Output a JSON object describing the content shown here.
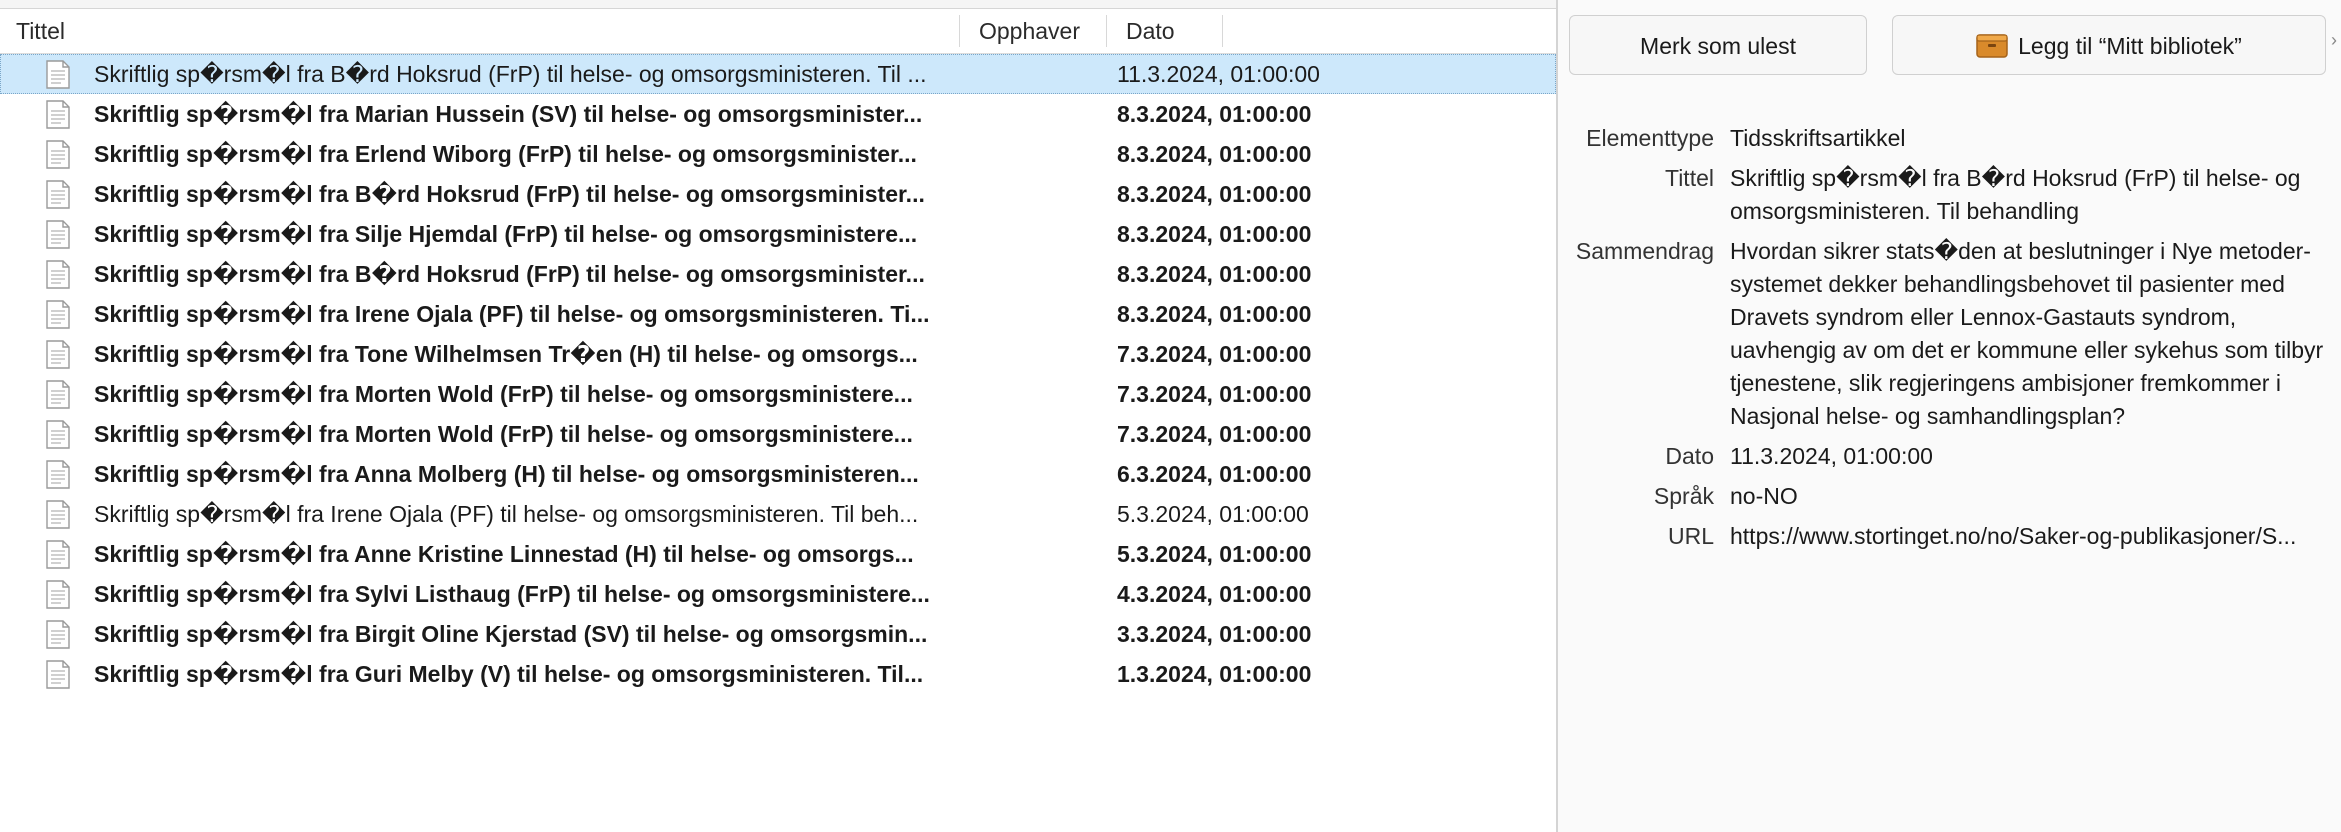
{
  "columns": {
    "title": "Tittel",
    "creator": "Opphaver",
    "date": "Dato"
  },
  "rows": [
    {
      "title": "Skriftlig sp�rsm�l fra B�rd Hoksrud (FrP) til helse- og omsorgsministeren. Til ...",
      "date": "11.3.2024, 01:00:00",
      "selected": true,
      "unread": false
    },
    {
      "title": "Skriftlig sp�rsm�l fra Marian Hussein (SV) til helse- og omsorgsminister...",
      "date": "8.3.2024, 01:00:00",
      "selected": false,
      "unread": true
    },
    {
      "title": "Skriftlig sp�rsm�l fra Erlend Wiborg (FrP) til helse- og omsorgsminister...",
      "date": "8.3.2024, 01:00:00",
      "selected": false,
      "unread": true
    },
    {
      "title": "Skriftlig sp�rsm�l fra B�rd Hoksrud (FrP) til helse- og omsorgsminister...",
      "date": "8.3.2024, 01:00:00",
      "selected": false,
      "unread": true
    },
    {
      "title": "Skriftlig sp�rsm�l fra Silje Hjemdal (FrP) til helse- og omsorgsministere...",
      "date": "8.3.2024, 01:00:00",
      "selected": false,
      "unread": true
    },
    {
      "title": "Skriftlig sp�rsm�l fra B�rd Hoksrud (FrP) til helse- og omsorgsminister...",
      "date": "8.3.2024, 01:00:00",
      "selected": false,
      "unread": true
    },
    {
      "title": "Skriftlig sp�rsm�l fra Irene Ojala (PF) til helse- og omsorgsministeren. Ti...",
      "date": "8.3.2024, 01:00:00",
      "selected": false,
      "unread": true
    },
    {
      "title": "Skriftlig sp�rsm�l fra Tone Wilhelmsen Tr�en (H) til helse- og omsorgs...",
      "date": "7.3.2024, 01:00:00",
      "selected": false,
      "unread": true
    },
    {
      "title": "Skriftlig sp�rsm�l fra Morten Wold (FrP) til helse- og omsorgsministere...",
      "date": "7.3.2024, 01:00:00",
      "selected": false,
      "unread": true
    },
    {
      "title": "Skriftlig sp�rsm�l fra Morten Wold (FrP) til helse- og omsorgsministere...",
      "date": "7.3.2024, 01:00:00",
      "selected": false,
      "unread": true
    },
    {
      "title": "Skriftlig sp�rsm�l fra Anna Molberg (H) til helse- og omsorgsministeren...",
      "date": "6.3.2024, 01:00:00",
      "selected": false,
      "unread": true
    },
    {
      "title": "Skriftlig sp�rsm�l fra Irene Ojala (PF) til helse- og omsorgsministeren. Til beh...",
      "date": "5.3.2024, 01:00:00",
      "selected": false,
      "unread": false
    },
    {
      "title": "Skriftlig sp�rsm�l fra Anne Kristine Linnestad (H) til helse- og omsorgs...",
      "date": "5.3.2024, 01:00:00",
      "selected": false,
      "unread": true
    },
    {
      "title": "Skriftlig sp�rsm�l fra Sylvi Listhaug (FrP) til helse- og omsorgsministere...",
      "date": "4.3.2024, 01:00:00",
      "selected": false,
      "unread": true
    },
    {
      "title": "Skriftlig sp�rsm�l fra Birgit Oline Kjerstad (SV) til helse- og omsorgsmin...",
      "date": "3.3.2024, 01:00:00",
      "selected": false,
      "unread": true
    },
    {
      "title": "Skriftlig sp�rsm�l fra Guri Melby (V) til helse- og omsorgsministeren. Til...",
      "date": "1.3.2024, 01:00:00",
      "selected": false,
      "unread": true
    }
  ],
  "toolbar": {
    "mark_unread": "Merk som ulest",
    "add_to_library": "Legg til “Mitt bibliotek”"
  },
  "item": {
    "fields": [
      {
        "label": "Elementtype",
        "value": "Tidsskriftsartikkel"
      },
      {
        "label": "Tittel",
        "value": "Skriftlig sp�rsm�l fra B�rd Hoksrud (FrP) til helse- og omsorgsministeren. Til behandling"
      },
      {
        "label": "Sammendrag",
        "value": "Hvordan sikrer stats�den at beslutninger i Nye metoder-systemet dekker behandlingsbehovet til pasienter med Dravets syndrom eller Lennox-Gastauts syndrom, uavhengig av om det er kommune eller sykehus som tilbyr tjenestene, slik regjeringens ambisjoner fremkommer i Nasjonal helse- og samhandlingsplan?"
      },
      {
        "label": "Dato",
        "value": "11.3.2024, 01:00:00"
      },
      {
        "label": "Språk",
        "value": "no-NO"
      },
      {
        "label": "URL",
        "value": "https://www.stortinget.no/no/Saker-og-publikasjoner/S..."
      }
    ]
  },
  "colors": {
    "selected_row": "#cde8fb",
    "library_icon": "#d98a2b"
  },
  "icons": {
    "row": "document-icon",
    "library": "library-box-icon"
  }
}
